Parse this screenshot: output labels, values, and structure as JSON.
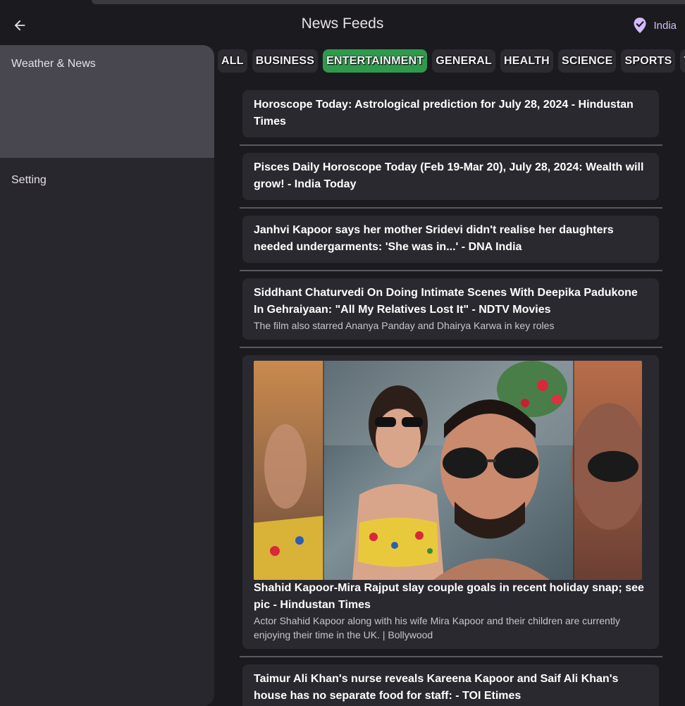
{
  "appbar": {
    "title": "News Feeds",
    "region_label": "India",
    "back_icon": "arrow-left-icon",
    "region_icon": "location-check-icon"
  },
  "drawer": {
    "items": [
      {
        "label": "Weather & News",
        "active": true
      },
      {
        "label": "Setting",
        "active": false
      }
    ]
  },
  "categories": {
    "items": [
      "ALL",
      "BUSINESS",
      "ENTERTAINMENT",
      "GENERAL",
      "HEALTH",
      "SCIENCE",
      "SPORTS",
      "TE"
    ],
    "selected": "ENTERTAINMENT"
  },
  "articles": [
    {
      "title": "Horoscope Today: Astrological prediction for July 28, 2024 - Hindustan Times",
      "description": ""
    },
    {
      "title": "Pisces Daily Horoscope Today (Feb 19-Mar 20), July 28, 2024: Wealth will grow! - India Today",
      "description": ""
    },
    {
      "title": "Janhvi Kapoor says her mother Sridevi didn't realise her daughters needed undergarments: 'She was in...' - DNA India",
      "description": ""
    },
    {
      "title": "Siddhant Chaturvedi On Doing Intimate Scenes With Deepika Padukone In Gehraiyaan: \"All My Relatives Lost It\" - NDTV Movies",
      "description": "The film also starred Ananya Panday and Dhairya Karwa in key roles"
    },
    {
      "title": "Shahid Kapoor-Mira Rajput slay couple goals in recent holiday snap; see pic - Hindustan Times",
      "description": "Actor Shahid Kapoor along with his wife Mira Kapoor and their children are currently enjoying their time in the UK. | Bollywood",
      "has_image": true
    },
    {
      "title": "Taimur Ali Khan's nurse reveals Kareena Kapoor and Saif Ali Khan's house has no separate food for staff: - TOI Etimes",
      "description": ""
    }
  ],
  "colors": {
    "background": "#1b1b1f",
    "drawer": "#28272d",
    "drawer_active": "#48464f",
    "chip_active": "#2f9a4e",
    "card": "#2a292f",
    "accent": "#d4bbff"
  }
}
